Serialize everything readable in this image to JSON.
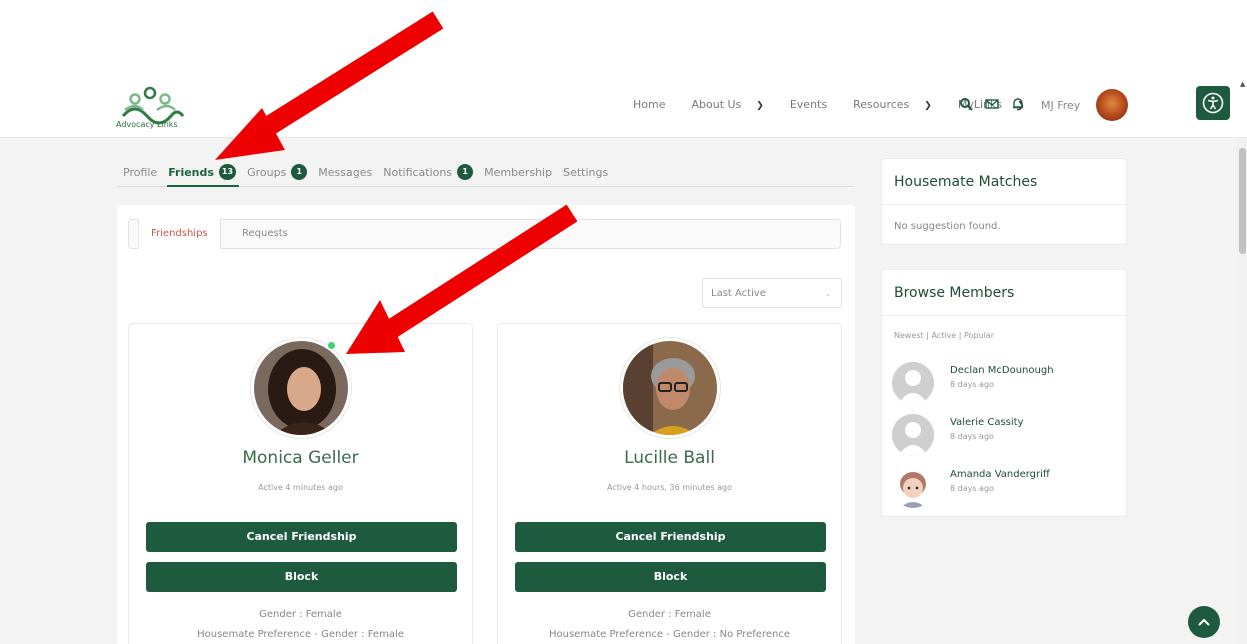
{
  "brand": {
    "logo_text": "Advocacy Links"
  },
  "nav": {
    "items": [
      {
        "label": "Home",
        "has_caret": false
      },
      {
        "label": "About Us",
        "has_caret": true
      },
      {
        "label": "Events",
        "has_caret": false
      },
      {
        "label": "Resources",
        "has_caret": true
      },
      {
        "label": "MyLinks",
        "has_caret": true
      }
    ],
    "user_name": "MJ Frey"
  },
  "profile_nav": {
    "items": [
      {
        "label": "Profile",
        "badge": ""
      },
      {
        "label": "Friends",
        "badge": "13"
      },
      {
        "label": "Groups",
        "badge": "1"
      },
      {
        "label": "Messages",
        "badge": ""
      },
      {
        "label": "Notifications",
        "badge": "1"
      },
      {
        "label": "Membership",
        "badge": ""
      },
      {
        "label": "Settings",
        "badge": ""
      }
    ],
    "active": "Friends"
  },
  "friends_tabs": {
    "friendships": "Friendships",
    "requests": "Requests"
  },
  "sort": {
    "selected": "Last Active"
  },
  "members": [
    {
      "name": "Monica Geller",
      "active": "Active 4 minutes ago",
      "online": true,
      "cancel_label": "Cancel Friendship",
      "block_label": "Block",
      "gender": "Gender : Female",
      "housemate_pref": "Housemate Preference - Gender : Female"
    },
    {
      "name": "Lucille Ball",
      "active": "Active 4 hours, 36 minutes ago",
      "online": false,
      "cancel_label": "Cancel Friendship",
      "block_label": "Block",
      "gender": "Gender : Female",
      "housemate_pref": "Housemate Preference - Gender : No Preference"
    }
  ],
  "housemate_matches": {
    "title": "Housemate Matches",
    "empty": "No suggestion found."
  },
  "browse_members": {
    "title": "Browse Members",
    "filter": "Newest | Active | Popular",
    "items": [
      {
        "name": "Declan McDounough",
        "time": "8 days ago"
      },
      {
        "name": "Valerie Cassity",
        "time": "8 days ago"
      },
      {
        "name": "Amanda Vandergriff",
        "time": "8 days ago"
      }
    ]
  },
  "colors": {
    "brand_green": "#1e5a3e",
    "active_tab_red": "#c9564d",
    "online_dot": "#3ed36b",
    "annotation_arrow": "#ee0000"
  }
}
